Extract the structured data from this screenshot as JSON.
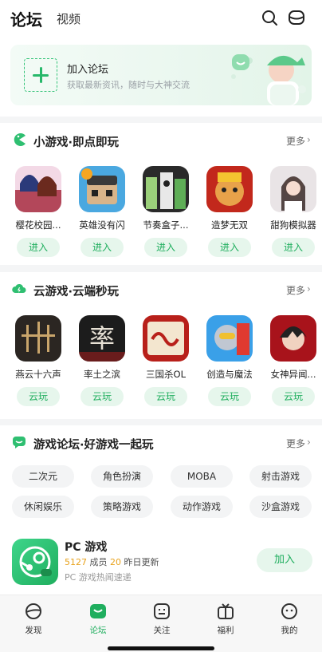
{
  "header": {
    "tab_forum": "论坛",
    "tab_video": "视频",
    "search_icon": "search-icon",
    "message_icon": "message-icon"
  },
  "banner": {
    "title": "加入论坛",
    "subtitle": "获取最新资讯，随时与大神交流"
  },
  "mini_games": {
    "title": "小游戏·即点即玩",
    "more": "更多",
    "games": [
      {
        "name": "樱花校园...",
        "button": "进入"
      },
      {
        "name": "英雄没有闪",
        "button": "进入"
      },
      {
        "name": "节奏盒子...",
        "button": "进入"
      },
      {
        "name": "造梦无双",
        "button": "进入"
      },
      {
        "name": "甜狗模拟器",
        "button": "进入"
      }
    ]
  },
  "cloud_games": {
    "title": "云游戏·云端秒玩",
    "more": "更多",
    "games": [
      {
        "name": "燕云十六声",
        "button": "云玩"
      },
      {
        "name": "率土之滨",
        "button": "云玩"
      },
      {
        "name": "三国杀OL",
        "button": "云玩"
      },
      {
        "name": "创造与魔法",
        "button": "云玩"
      },
      {
        "name": "女神异闻...",
        "button": "云玩"
      }
    ]
  },
  "forum": {
    "title": "游戏论坛·好游戏一起玩",
    "more": "更多",
    "tags": [
      "二次元",
      "角色扮演",
      "MOBA",
      "射击游戏",
      "休闲娱乐",
      "策略游戏",
      "动作游戏",
      "沙盒游戏"
    ],
    "pc": {
      "title": "PC 游戏",
      "members": "5127",
      "members_label": " 成员  ",
      "updates": "20",
      "updates_label": " 昨日更新",
      "desc": "PC 游戏热闻速递",
      "join": "加入"
    }
  },
  "bottom_nav": {
    "items": [
      {
        "label": "发现",
        "icon": "discover-icon"
      },
      {
        "label": "论坛",
        "icon": "forum-icon"
      },
      {
        "label": "关注",
        "icon": "follow-icon"
      },
      {
        "label": "福利",
        "icon": "gift-icon"
      },
      {
        "label": "我的",
        "icon": "profile-icon"
      }
    ],
    "active": "论坛"
  },
  "colors": {
    "accent": "#1fae5e",
    "accent_bg": "#e6f6ec",
    "stat_highlight": "#e8a21c"
  }
}
